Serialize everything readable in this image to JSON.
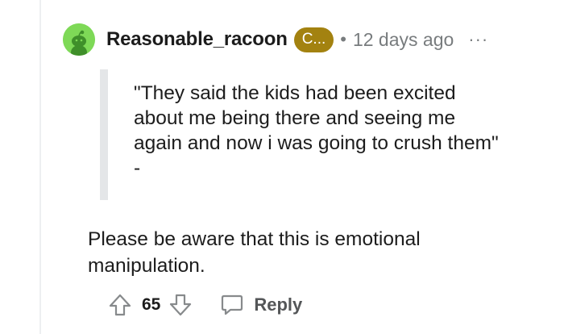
{
  "comment": {
    "author": "Reasonable_racoon",
    "flair": "C...",
    "separator": "•",
    "timestamp": "12 days ago",
    "more_label": "···",
    "quote": "\"They said the kids had been excited about me being there and seeing me again and now i was going to crush them\" -",
    "body": "Please be aware that this is emotional manipulation.",
    "votes": "65",
    "reply_label": "Reply"
  },
  "icons": {
    "avatar": "snoo-avatar-icon",
    "upvote": "upvote-arrow-icon",
    "downvote": "downvote-arrow-icon",
    "reply": "speech-bubble-icon",
    "more": "more-options-icon"
  },
  "colors": {
    "avatar_bg": "#7ed957",
    "flair_bg": "#a38210",
    "meta_text": "#787c7e",
    "quote_bar": "#e4e6e8"
  }
}
